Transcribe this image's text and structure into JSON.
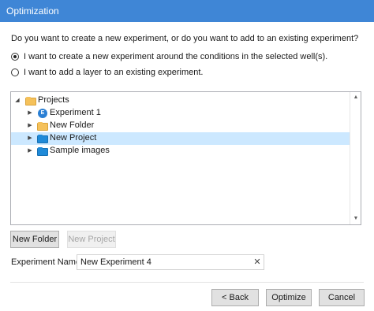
{
  "window": {
    "title": "Optimization"
  },
  "question": "Do you want to create a new experiment, or do you want to add to an existing experiment?",
  "options": [
    {
      "label": "I want to create a new experiment around the conditions in the selected well(s).",
      "checked": true
    },
    {
      "label": "I want to add a layer to an existing experiment.",
      "checked": false
    }
  ],
  "tree": {
    "root": {
      "label": "Projects",
      "expanded": true,
      "icon": "folder-icon"
    },
    "children": [
      {
        "label": "Experiment 1",
        "icon": "experiment-icon",
        "selected": false
      },
      {
        "label": "New Folder",
        "icon": "folder-icon",
        "selected": false
      },
      {
        "label": "New Project",
        "icon": "project-folder-icon",
        "selected": true
      },
      {
        "label": "Sample images",
        "icon": "project-folder-icon",
        "selected": false
      }
    ]
  },
  "buttons": {
    "new_folder": "New Folder",
    "new_project": "New Project",
    "back": "< Back",
    "optimize": "Optimize",
    "cancel": "Cancel"
  },
  "experiment_name": {
    "label": "Experiment Name",
    "value": "New Experiment 4"
  },
  "colors": {
    "titlebar": "#3f86d6",
    "selection": "#cce8ff",
    "folder_yellow": "#f5c15a",
    "folder_blue": "#1f8ad8"
  }
}
